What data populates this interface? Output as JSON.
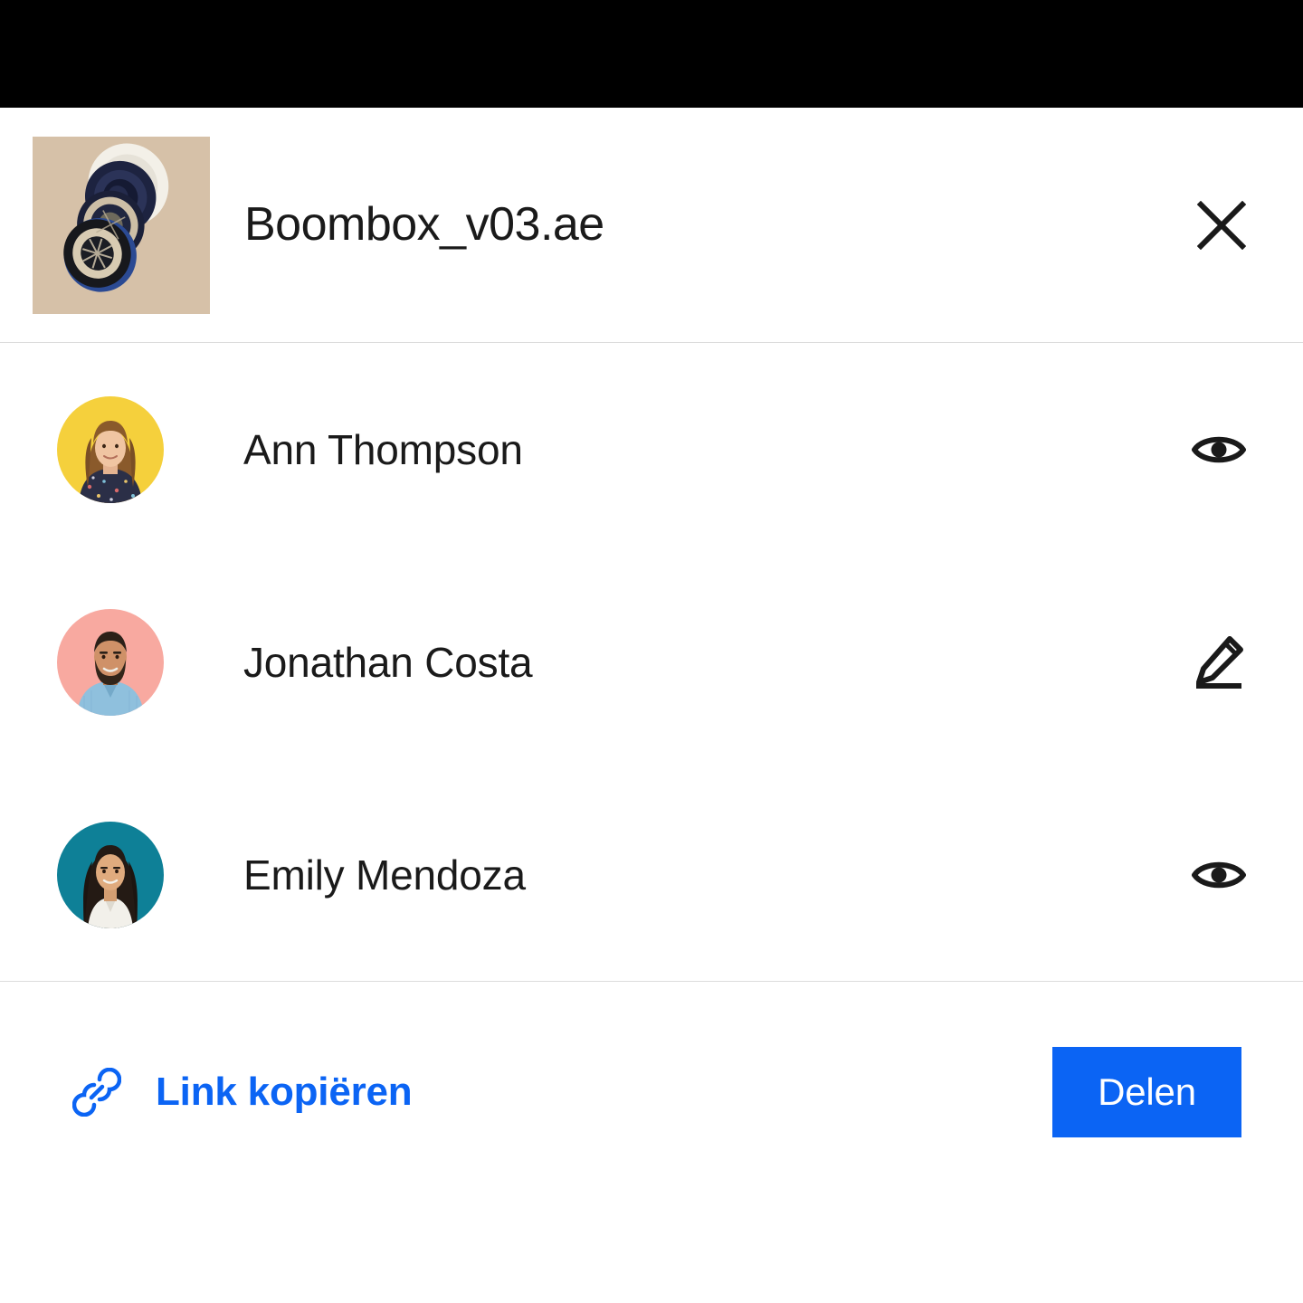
{
  "dialog": {
    "file": {
      "name": "Boombox_v03.ae",
      "thumbnail_alt": "exploded-speaker-render",
      "thumbnail_bg": "#d6c1a8"
    },
    "close_label": "×",
    "close_icon": "close-icon"
  },
  "people": [
    {
      "name": "Ann Thompson",
      "permission": "view",
      "permission_icon": "eye-icon",
      "avatar_bg": "#f5d03c",
      "avatar_alt": "ann-thompson-photo"
    },
    {
      "name": "Jonathan Costa",
      "permission": "edit",
      "permission_icon": "pencil-icon",
      "avatar_bg": "#f8a9a0",
      "avatar_alt": "jonathan-costa-photo"
    },
    {
      "name": "Emily Mendoza",
      "permission": "view",
      "permission_icon": "eye-icon",
      "avatar_bg": "#0e8097",
      "avatar_alt": "emily-mendoza-photo"
    }
  ],
  "footer": {
    "copy_link_label": "Link kopiëren",
    "copy_link_icon": "link-icon",
    "share_button_label": "Delen"
  },
  "colors": {
    "accent": "#0b64f4",
    "text": "#1a1a1a",
    "divider": "#dcdcdc",
    "top_band": "#000000",
    "surface": "#ffffff"
  }
}
